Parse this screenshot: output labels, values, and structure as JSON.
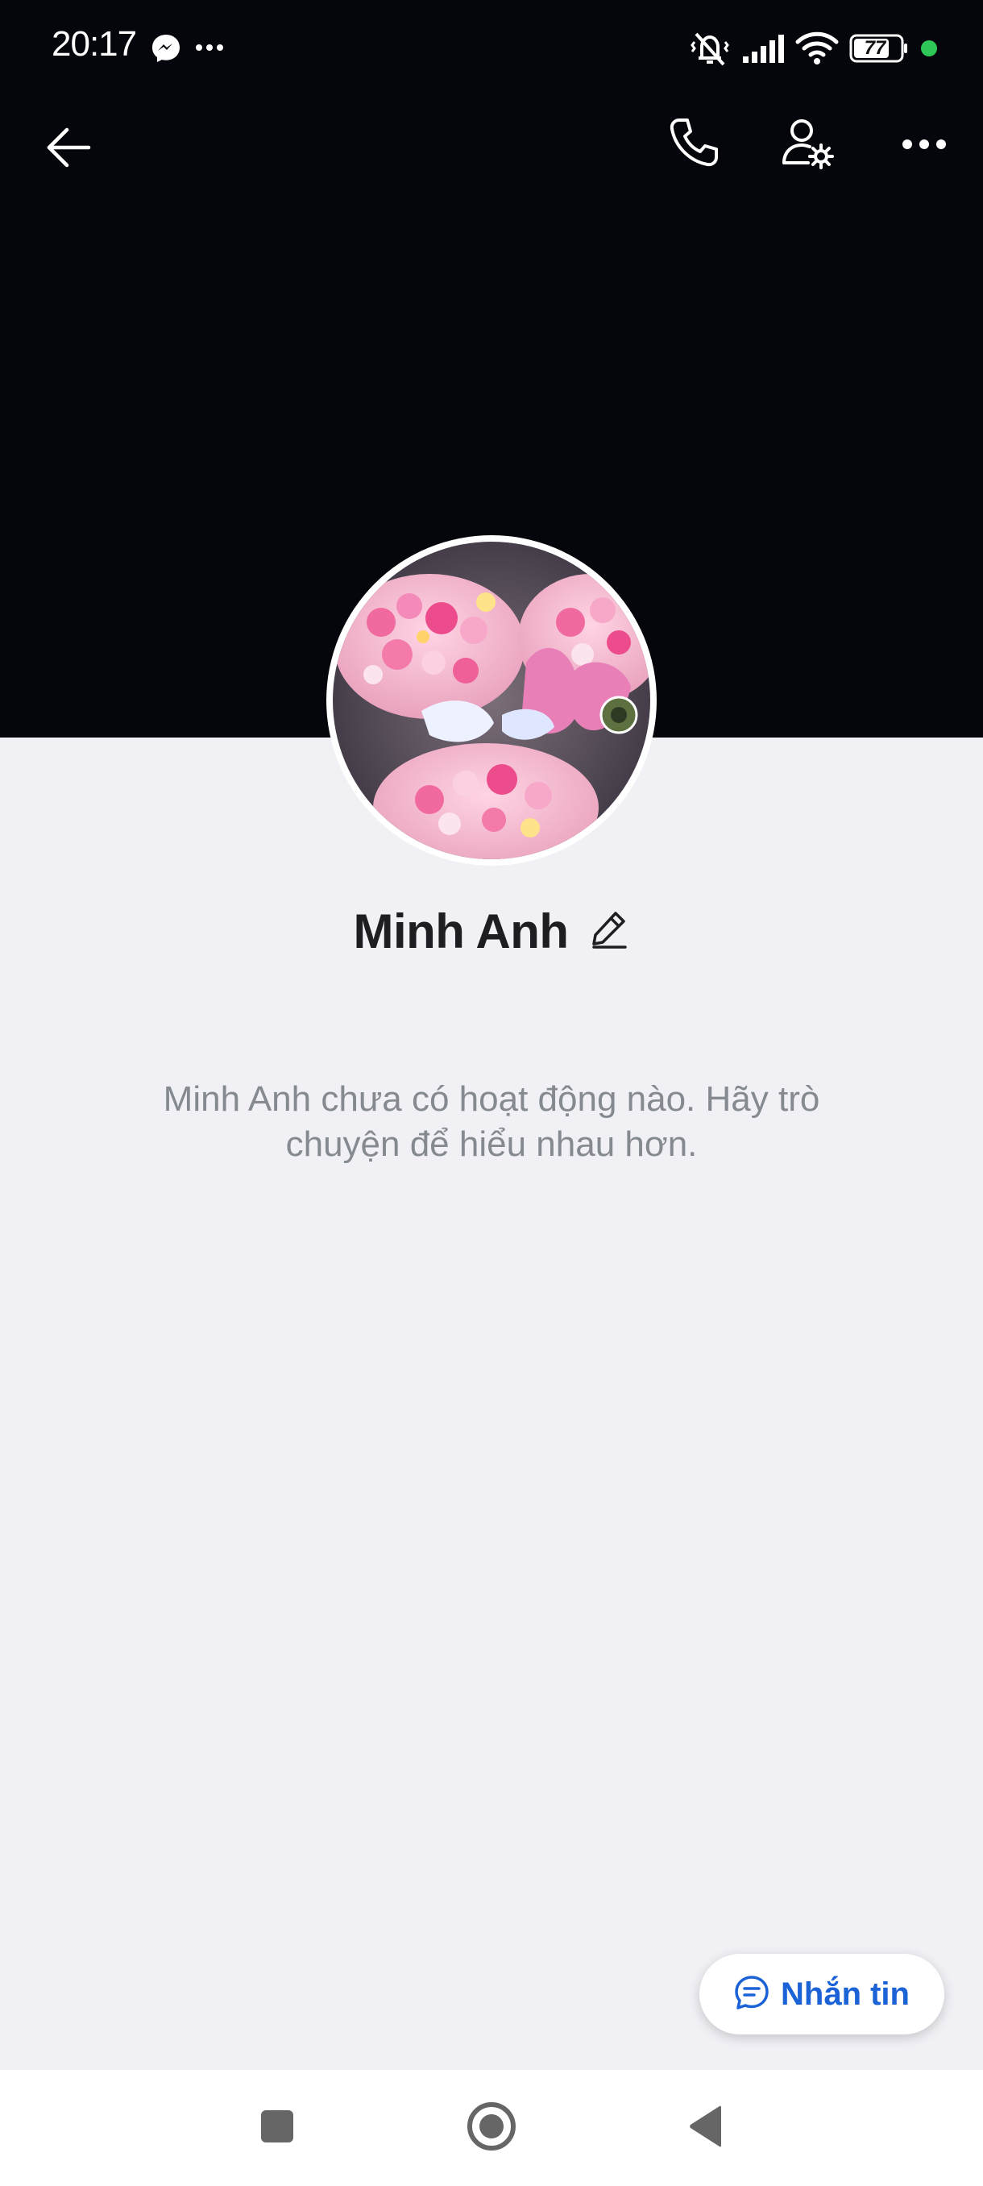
{
  "status_bar": {
    "time": "20:17",
    "battery_level": "77",
    "icons": [
      "messenger-icon",
      "more-notifications-icon",
      "silent-vibrate-icon",
      "signal-icon",
      "wifi-icon",
      "battery-icon",
      "active-dot-icon"
    ],
    "active_dot_color": "#2fc757"
  },
  "toolbar": {
    "back_icon": "arrow-left-icon",
    "call_icon": "phone-icon",
    "settings_icon": "user-settings-icon",
    "more_icon": "more-horizontal-icon"
  },
  "profile": {
    "name": "Minh Anh",
    "avatar_icon": "profile-photo",
    "edit_icon": "pencil-icon",
    "empty_message": "Minh Anh chưa có hoạt động nào. Hãy trò chuyện để hiểu nhau hơn."
  },
  "actions": {
    "message_label": "Nhắn tin",
    "message_icon": "chat-bubble-icon",
    "accent_color": "#1a62d6"
  },
  "nav_bar": {
    "recents_icon": "square-icon",
    "home_icon": "circle-home-icon",
    "back_icon": "triangle-back-icon"
  },
  "colors": {
    "cover": "#05050c",
    "background": "#f0f0f5"
  }
}
